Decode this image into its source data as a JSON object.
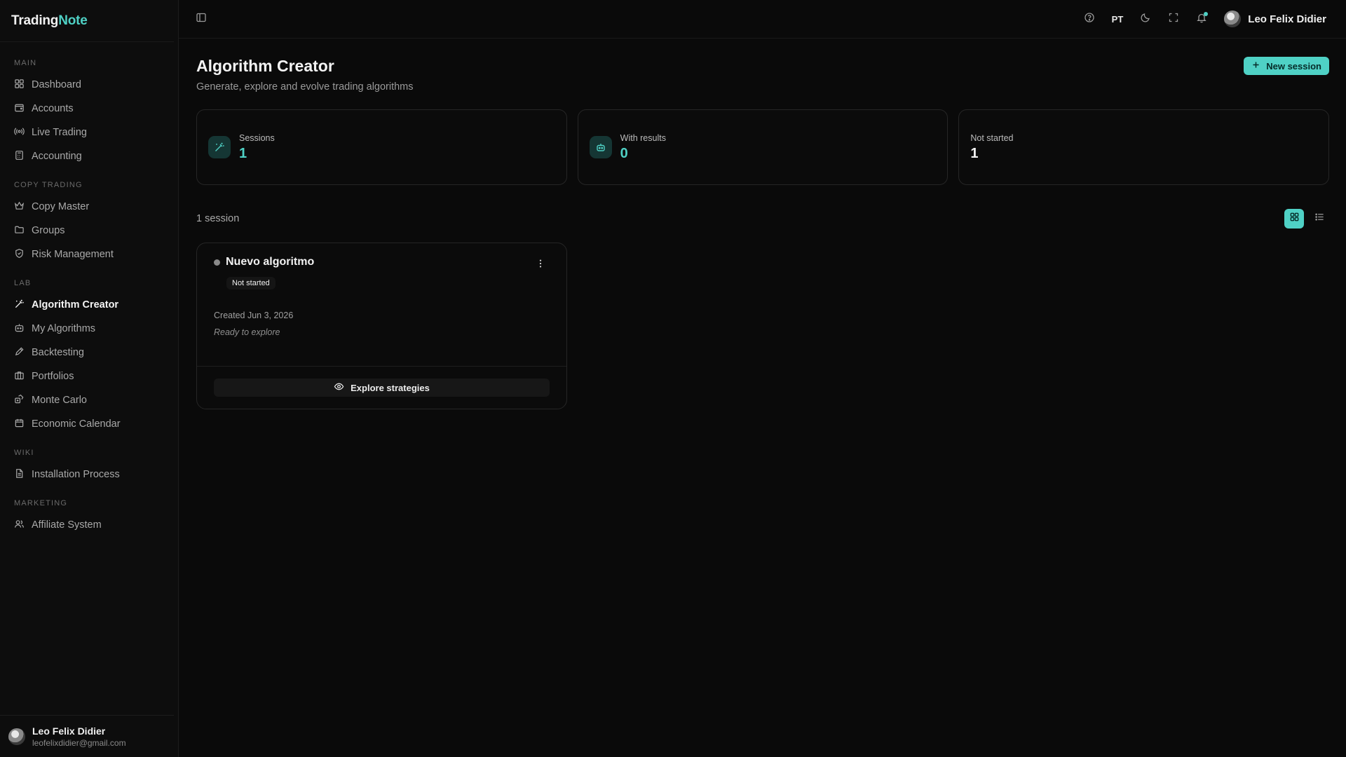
{
  "brand": {
    "part1": "Trading",
    "part2": "Note"
  },
  "sidebar": {
    "sections": [
      {
        "label": "MAIN",
        "items": [
          {
            "label": "Dashboard",
            "icon": "grid-icon"
          },
          {
            "label": "Accounts",
            "icon": "wallet-icon"
          },
          {
            "label": "Live Trading",
            "icon": "radio-icon"
          },
          {
            "label": "Accounting",
            "icon": "calculator-icon"
          }
        ]
      },
      {
        "label": "COPY TRADING",
        "items": [
          {
            "label": "Copy Master",
            "icon": "crown-icon"
          },
          {
            "label": "Groups",
            "icon": "folder-icon"
          },
          {
            "label": "Risk Management",
            "icon": "shield-icon"
          }
        ]
      },
      {
        "label": "LAB",
        "items": [
          {
            "label": "Algorithm Creator",
            "icon": "magic-wand-icon",
            "active": true
          },
          {
            "label": "My Algorithms",
            "icon": "bot-icon"
          },
          {
            "label": "Backtesting",
            "icon": "pencil-icon"
          },
          {
            "label": "Portfolios",
            "icon": "briefcase-icon"
          },
          {
            "label": "Monte Carlo",
            "icon": "dice-icon"
          },
          {
            "label": "Economic Calendar",
            "icon": "calendar-icon"
          }
        ]
      },
      {
        "label": "WIKI",
        "items": [
          {
            "label": "Installation Process",
            "icon": "file-text-icon"
          }
        ]
      },
      {
        "label": "MARKETING",
        "items": [
          {
            "label": "Affiliate System",
            "icon": "users-icon"
          }
        ]
      }
    ]
  },
  "user": {
    "name": "Leo Felix Didier",
    "email": "leofelixdidier@gmail.com"
  },
  "topbar": {
    "lang": "PT"
  },
  "page": {
    "title": "Algorithm Creator",
    "subtitle": "Generate, explore and evolve trading algorithms",
    "new_session_label": "New session"
  },
  "stats": [
    {
      "label": "Sessions",
      "value": "1",
      "icon": "magic-wand-icon"
    },
    {
      "label": "With results",
      "value": "0",
      "icon": "bot-icon"
    },
    {
      "label": "Not started",
      "value": "1"
    }
  ],
  "list": {
    "count_text": "1 session"
  },
  "card": {
    "title": "Nuevo algoritmo",
    "badge": "Not started",
    "created": "Created Jun 3, 2026",
    "note": "Ready to explore",
    "action_label": "Explore strategies"
  },
  "colors": {
    "accent": "#4fd1c5",
    "background": "#0a0a0a"
  }
}
